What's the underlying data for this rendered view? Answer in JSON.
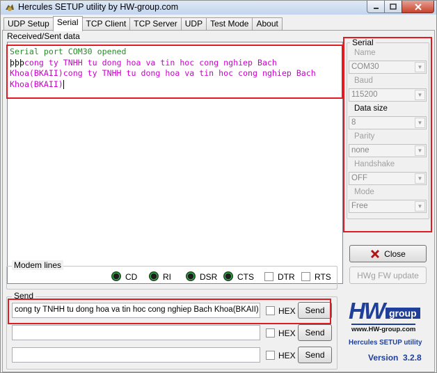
{
  "window": {
    "title": "Hercules SETUP utility by HW-group.com"
  },
  "tabs": [
    {
      "label": "UDP Setup"
    },
    {
      "label": "Serial"
    },
    {
      "label": "TCP Client"
    },
    {
      "label": "TCP Server"
    },
    {
      "label": "UDP"
    },
    {
      "label": "Test Mode"
    },
    {
      "label": "About"
    }
  ],
  "received": {
    "label": "Received/Sent data",
    "line_status": "Serial port COM30 opened",
    "line_prefix": "þþþ",
    "line_data": "cong ty TNHH tu dong hoa va tin hoc cong nghiep Bach Khoa(BKAII)cong ty TNHH tu dong hoa va tin hoc cong nghiep Bach Khoa(BKAII)"
  },
  "serial": {
    "title": "Serial",
    "name_label": "Name",
    "name_value": "COM30",
    "baud_label": "Baud",
    "baud_value": "115200",
    "datasize_label": "Data size",
    "datasize_value": "8",
    "parity_label": "Parity",
    "parity_value": "none",
    "handshake_label": "Handshake",
    "handshake_value": "OFF",
    "mode_label": "Mode",
    "mode_value": "Free"
  },
  "buttons": {
    "close": "Close",
    "hwg_update": "HWg FW update"
  },
  "modem": {
    "title": "Modem lines",
    "cd": "CD",
    "ri": "RI",
    "dsr": "DSR",
    "cts": "CTS",
    "dtr": "DTR",
    "rts": "RTS"
  },
  "send": {
    "title": "Send",
    "rows": [
      {
        "value": "cong ty TNHH tu dong hoa va tin hoc cong nghiep Bach Khoa(BKAII)",
        "hex": "HEX",
        "button": "Send"
      },
      {
        "value": "",
        "hex": "HEX",
        "button": "Send"
      },
      {
        "value": "",
        "hex": "HEX",
        "button": "Send"
      }
    ]
  },
  "logo": {
    "brand_hw": "HW",
    "brand_group": "group",
    "url": "www.HW-group.com",
    "product": "Hercules SETUP utility",
    "version": "Version  3.2.8"
  },
  "colors": {
    "highlight": "#e11b22",
    "status_text": "#2a8c2a",
    "data_text": "#cc00cc",
    "brand_blue": "#1f3f99"
  }
}
